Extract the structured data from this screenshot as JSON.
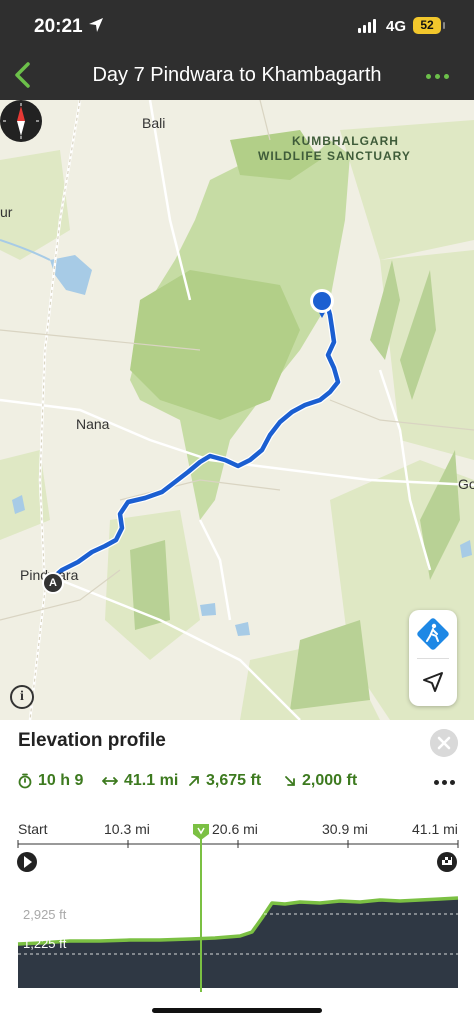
{
  "status": {
    "time": "20:21",
    "network": "4G",
    "battery": "52"
  },
  "nav": {
    "title": "Day 7 Pindwara to Khambagarth"
  },
  "map": {
    "labels": {
      "bali": "Bali",
      "park_line1": "KUMBHALGARH",
      "park_line2": "WILDLIFE SANCTUARY",
      "ur": "ur",
      "nana": "Nana",
      "go": "Go",
      "pindwara": "Pindwara"
    },
    "start_marker": "A",
    "route_color": "#1b5fd1",
    "park_color": "#c6dca4"
  },
  "panel": {
    "title": "Elevation profile",
    "stats": {
      "duration": "10 h 9",
      "distance": "41.1 mi",
      "ascent": "3,675 ft",
      "descent": "2,000 ft"
    },
    "axis": {
      "start": "Start",
      "t1": "10.3 mi",
      "t2": "20.6 mi",
      "t3": "30.9 mi",
      "end": "41.1 mi"
    },
    "elevation": {
      "upper": "2,925 ft",
      "lower": "1,225 ft"
    },
    "accent": "#6cc04a"
  }
}
